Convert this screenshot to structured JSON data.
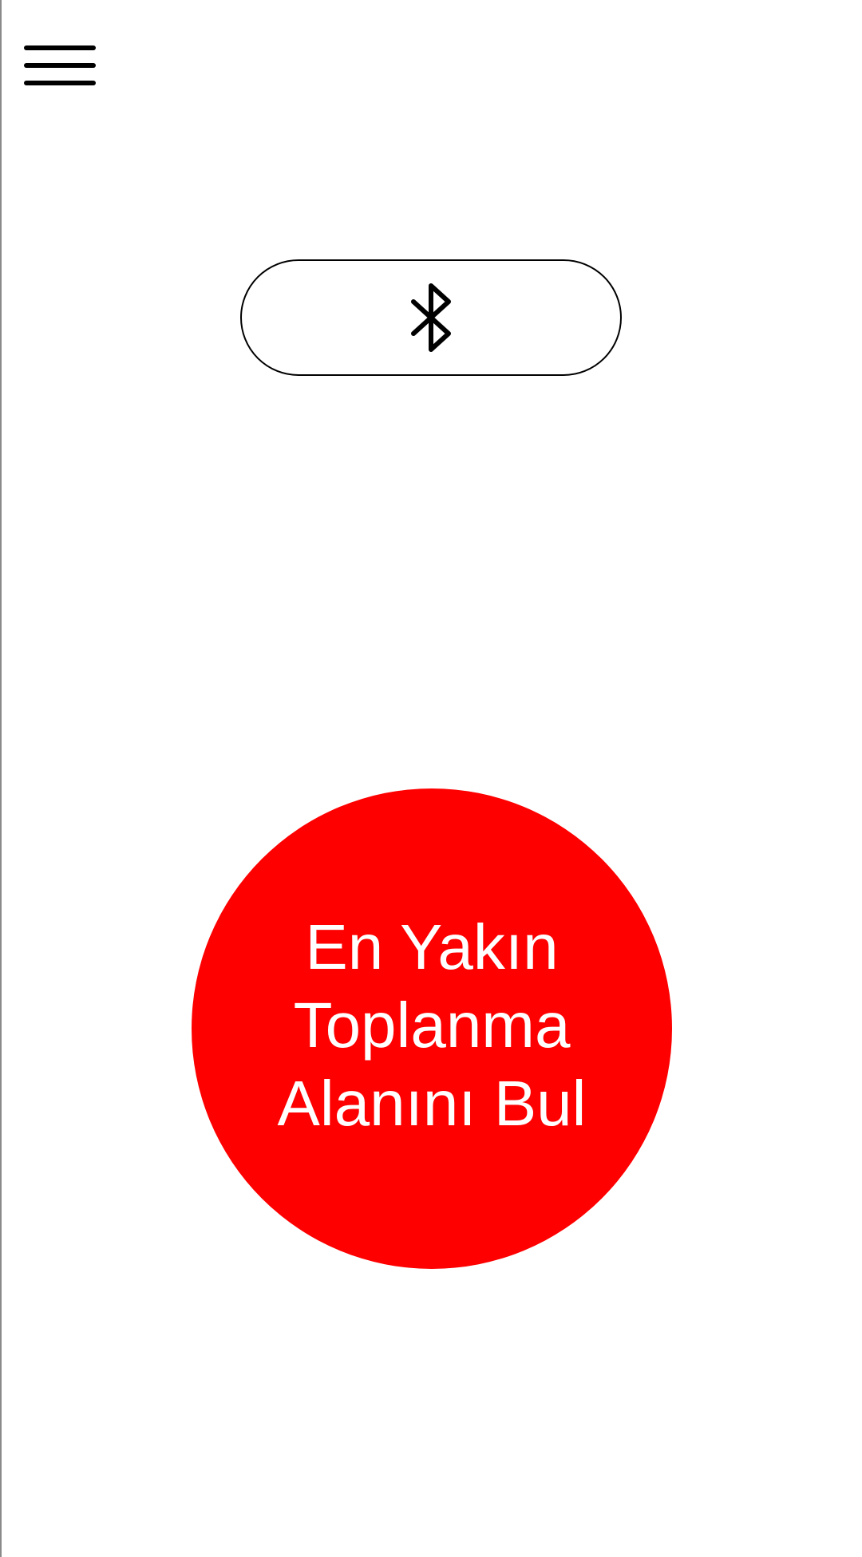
{
  "menu": {
    "icon": "hamburger-menu-icon"
  },
  "bluetooth": {
    "icon": "bluetooth-icon"
  },
  "find_button": {
    "lines": [
      "En Yakın",
      "Toplanma",
      "Alanını Bul"
    ],
    "color": "#fe0000",
    "text_color": "#ffffff"
  }
}
